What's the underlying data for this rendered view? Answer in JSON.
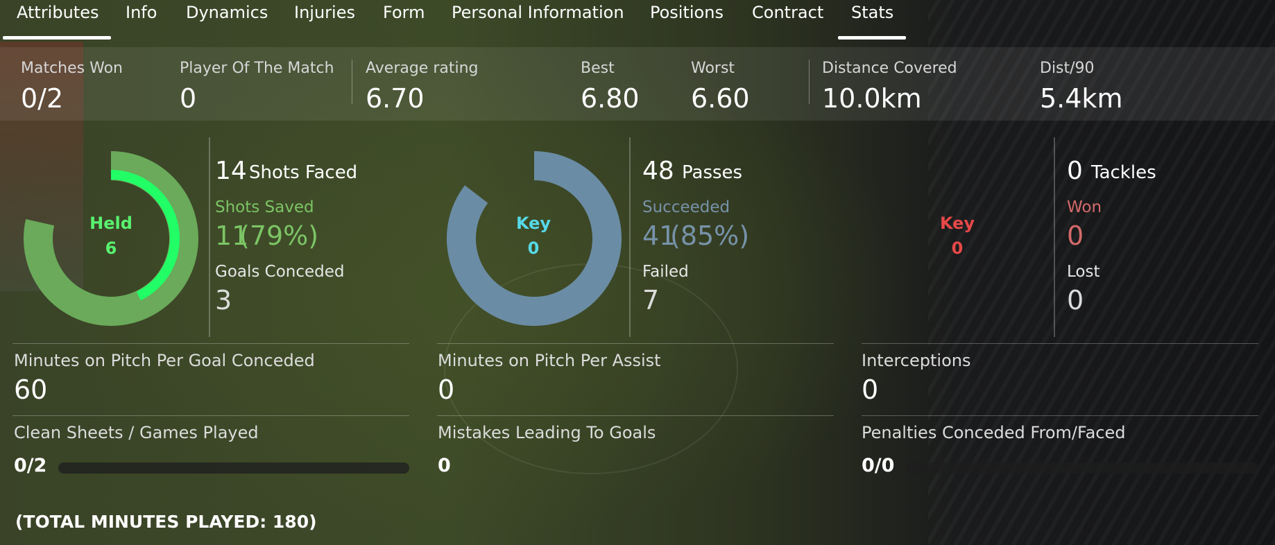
{
  "tabs": [
    {
      "label": "Attributes",
      "active": true
    },
    {
      "label": "Info",
      "active": false
    },
    {
      "label": "Dynamics",
      "active": false
    },
    {
      "label": "Injuries",
      "active": false
    },
    {
      "label": "Form",
      "active": false
    },
    {
      "label": "Personal Information",
      "active": false
    },
    {
      "label": "Positions",
      "active": false
    },
    {
      "label": "Contract",
      "active": false
    },
    {
      "label": "Stats",
      "active": true
    }
  ],
  "summary": {
    "matches_won": {
      "label": "Matches Won",
      "value": "0/2"
    },
    "player_of_match": {
      "label": "Player Of The Match",
      "value": "0"
    },
    "average_rating": {
      "label": "Average rating",
      "value": "6.70"
    },
    "best": {
      "label": "Best",
      "value": "6.80"
    },
    "worst": {
      "label": "Worst",
      "value": "6.60"
    },
    "distance": {
      "label": "Distance Covered",
      "value": "10.0km"
    },
    "dist90": {
      "label": "Dist/90",
      "value": "5.4km"
    }
  },
  "goalkeeping": {
    "donut": {
      "title": "Held",
      "value": "6",
      "total": 14,
      "saved": 11,
      "held": 6,
      "color_ring": "#6aaa5a",
      "color_inner": "#22ff66",
      "color_text": "#59f26f"
    },
    "count": "14",
    "count_label": "Shots Faced",
    "saved_label": "Shots Saved",
    "saved_value": "11",
    "saved_pct": "(79%)",
    "saved_color": "#7cc465",
    "conceded_label": "Goals Conceded",
    "conceded_value": "3"
  },
  "passing": {
    "donut": {
      "title": "Key",
      "value": "0",
      "total": 48,
      "succeeded": 41,
      "key": 0,
      "color_ring": "#6b8ca5",
      "color_text": "#56d9e8"
    },
    "count": "48",
    "count_label": "Passes",
    "succeeded_label": "Succeeded",
    "succeeded_value": "41",
    "succeeded_pct": "(85%)",
    "succeeded_color": "#7793aa",
    "failed_label": "Failed",
    "failed_value": "7"
  },
  "tackling": {
    "donut": {
      "title": "Key",
      "value": "0",
      "color_text": "#e84848"
    },
    "count": "0",
    "count_label": "Tackles",
    "won_label": "Won",
    "won_value": "0",
    "won_color": "#d46a6a",
    "lost_label": "Lost",
    "lost_value": "0"
  },
  "details": {
    "mins_per_goal_conceded": {
      "label": "Minutes on Pitch Per Goal Conceded",
      "value": "60"
    },
    "mins_per_assist": {
      "label": "Minutes on Pitch Per Assist",
      "value": "0"
    },
    "interceptions": {
      "label": "Interceptions",
      "value": "0"
    },
    "clean_sheets": {
      "label": "Clean Sheets / Games Played",
      "value": "0/2",
      "fraction": 0
    },
    "mistakes": {
      "label": "Mistakes Leading To Goals",
      "value": "0"
    },
    "penalties": {
      "label": "Penalties Conceded From/Faced",
      "value": "0/0",
      "fraction": 0
    }
  },
  "total_minutes": "(TOTAL MINUTES PLAYED: 180)"
}
